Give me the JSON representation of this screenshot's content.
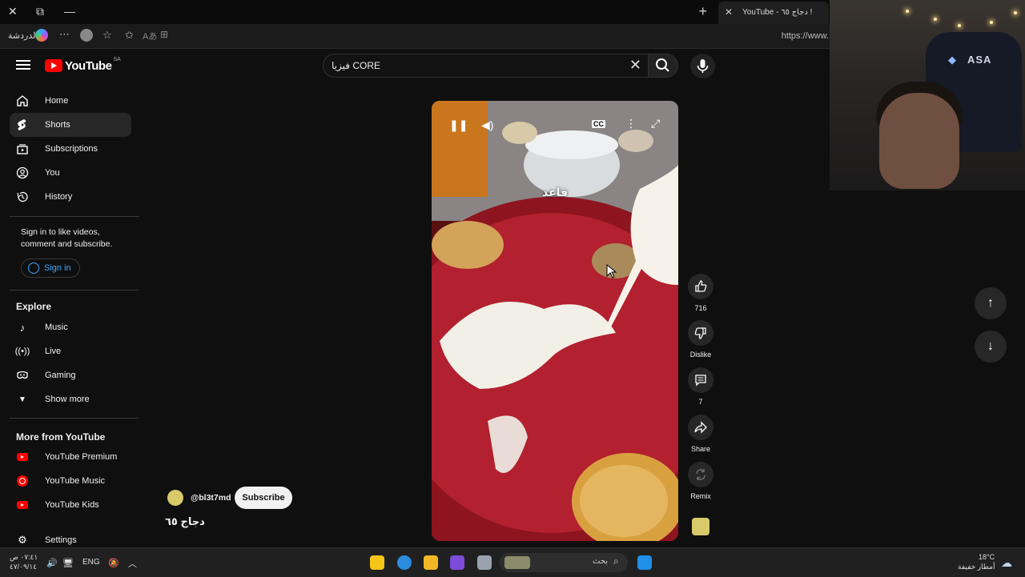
{
  "browser": {
    "tab_title": "YouTube - دجاج ٦٥ !",
    "url": "https://www.",
    "chat_label": "الدردشة"
  },
  "header": {
    "logo_text": "YouTube",
    "region": "SA",
    "search_value": "فيزيا  CORE"
  },
  "sidebar": {
    "items": [
      {
        "label": "Home",
        "icon": "home-icon"
      },
      {
        "label": "Shorts",
        "icon": "shorts-icon"
      },
      {
        "label": "Subscriptions",
        "icon": "subscriptions-icon"
      },
      {
        "label": "You",
        "icon": "you-icon"
      },
      {
        "label": "History",
        "icon": "history-icon"
      }
    ],
    "signin_prompt": "Sign in to like videos, comment and subscribe.",
    "signin_button": "Sign in",
    "explore_title": "Explore",
    "explore": [
      {
        "label": "Music",
        "icon": "music-icon"
      },
      {
        "label": "Live",
        "icon": "live-icon"
      },
      {
        "label": "Gaming",
        "icon": "gaming-icon"
      },
      {
        "label": "Show more",
        "icon": "chevron-down-icon"
      }
    ],
    "more_title": "More from YouTube",
    "more": [
      {
        "label": "YouTube Premium"
      },
      {
        "label": "YouTube Music"
      },
      {
        "label": "YouTube Kids"
      }
    ],
    "settings_label": "Settings"
  },
  "short": {
    "caption": "قاعد",
    "channel_handle": "@bl3t7md",
    "subscribe_label": "Subscribe",
    "title": "دجاج ٦٥",
    "likes": "716",
    "dislike_label": "Dislike",
    "comments": "7",
    "share_label": "Share",
    "remix_label": "Remix"
  },
  "taskbar": {
    "time": "٠٧:٤١ ص",
    "date": "٤٧/٠٩/١٤",
    "lang": "ENG",
    "search_placeholder": "بحث",
    "weather_temp": "18°C",
    "weather_desc": "أمطار خفيفة"
  }
}
